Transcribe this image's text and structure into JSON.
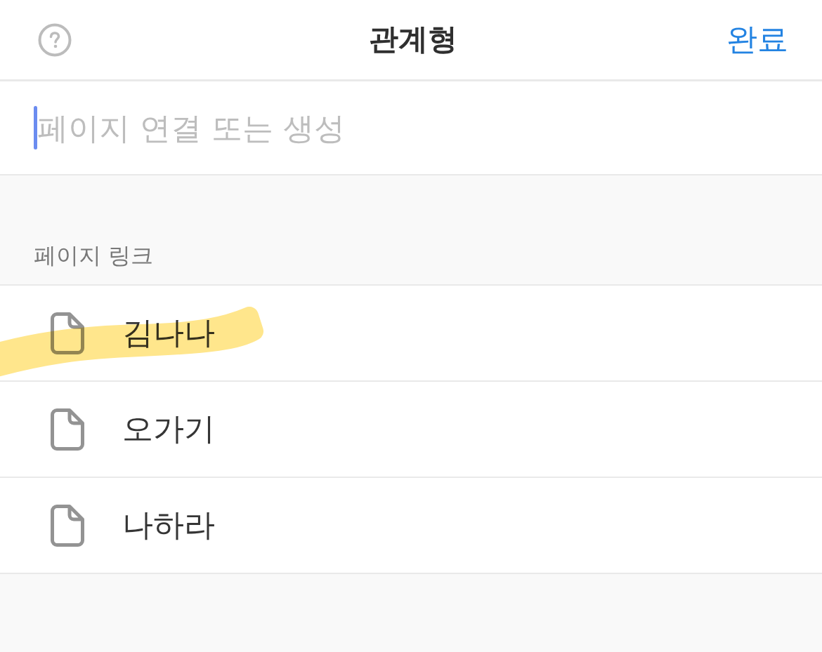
{
  "header": {
    "title": "관계형",
    "done_button": "완료"
  },
  "search": {
    "placeholder": "페이지 연결 또는 생성",
    "focused": true
  },
  "section": {
    "label": "페이지 링크"
  },
  "pages": [
    {
      "title": "김나나",
      "highlighted": true
    },
    {
      "title": "오가기",
      "highlighted": false
    },
    {
      "title": "나하라",
      "highlighted": false
    }
  ]
}
